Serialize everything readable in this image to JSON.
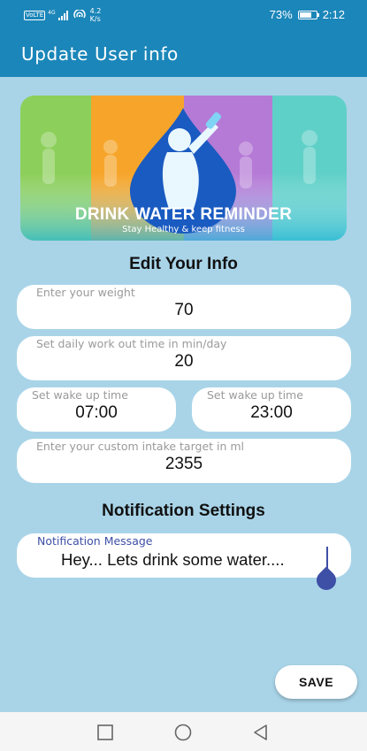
{
  "status_bar": {
    "network": "VoLTE",
    "signal": "4G",
    "speed_value": "4.2",
    "speed_unit": "K/s",
    "battery": "73%",
    "time": "2:12"
  },
  "app_bar": {
    "title": "Update User info"
  },
  "banner": {
    "title": "DRINK WATER REMINDER",
    "subtitle": "Stay Healthy & keep fitness"
  },
  "edit_section": {
    "title": "Edit Your Info"
  },
  "fields": {
    "weight": {
      "label": "Enter your weight",
      "value": "70"
    },
    "workout": {
      "label": "Set daily work out time in min/day",
      "value": "20"
    },
    "wake_up": {
      "label": "Set wake up time",
      "value": "07:00"
    },
    "sleep": {
      "label": "Set wake up time",
      "value": "23:00"
    },
    "intake": {
      "label": "Enter your custom intake target in ml",
      "value": "2355"
    }
  },
  "notification_section": {
    "title": "Notification Settings"
  },
  "notification": {
    "label": "Notification Message",
    "value": "Hey... Lets drink some water...."
  },
  "save_label": "SAVE",
  "colors": {
    "app_bar": "#1b86b9",
    "background": "#a9d4e8",
    "accent": "#3e4fa6"
  },
  "nav_icons": [
    "recents-square-icon",
    "home-circle-icon",
    "back-triangle-icon"
  ]
}
